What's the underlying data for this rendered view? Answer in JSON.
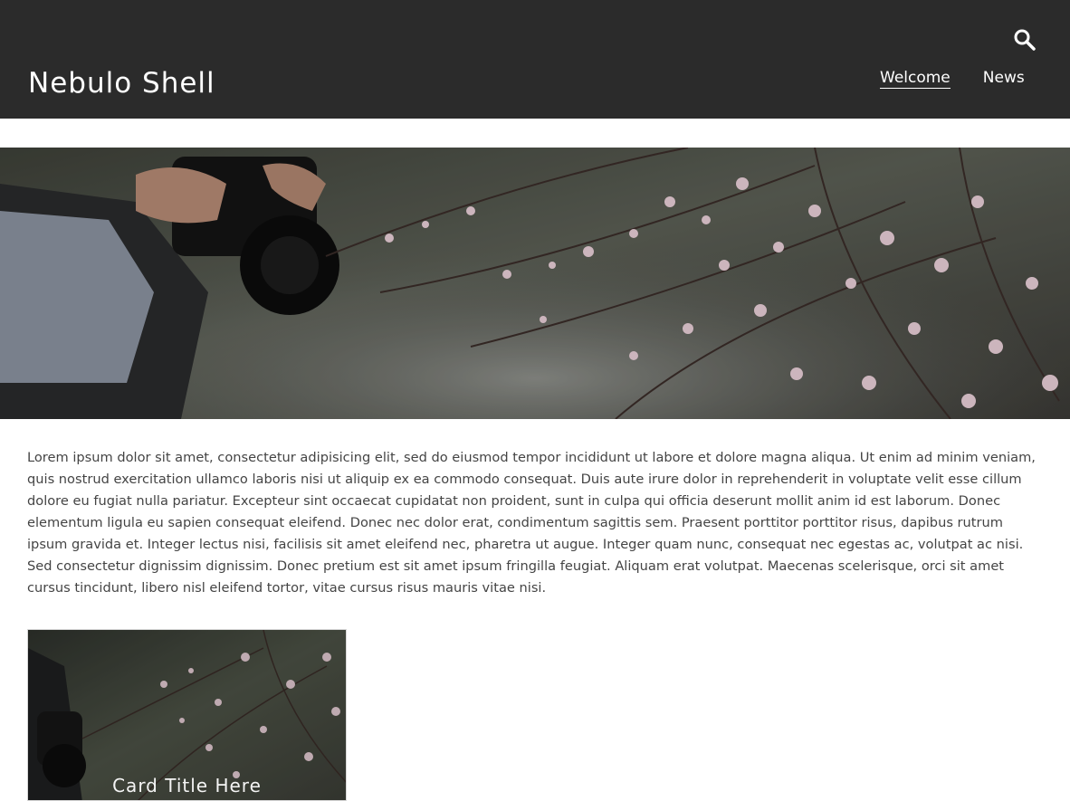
{
  "header": {
    "site_title": "Nebulo Shell",
    "search_icon": "search-icon",
    "nav": [
      {
        "label": "Welcome",
        "active": true
      },
      {
        "label": "News",
        "active": false
      }
    ]
  },
  "hero": {
    "image": "photo of hands holding a camera beside pink blossom branches"
  },
  "content": {
    "intro": "Lorem ipsum dolor sit amet, consectetur adipisicing elit, sed do eiusmod tempor incididunt ut labore et dolore magna aliqua. Ut enim ad minim veniam, quis nostrud exercitation ullamco laboris nisi ut aliquip ex ea commodo consequat. Duis aute irure dolor in reprehenderit in voluptate velit esse cillum dolore eu fugiat nulla pariatur. Excepteur sint occaecat cupidatat non proident, sunt in culpa qui officia deserunt mollit anim id est laborum. Donec elementum ligula eu sapien consequat eleifend. Donec nec dolor erat, condimentum sagittis sem. Praesent porttitor porttitor risus, dapibus rutrum ipsum gravida et. Integer lectus nisi, facilisis sit amet eleifend nec, pharetra ut augue. Integer quam nunc, consequat nec egestas ac, volutpat ac nisi. Sed consectetur dignissim dignissim. Donec pretium est sit amet ipsum fringilla feugiat. Aliquam erat volutpat. Maecenas scelerisque, orci sit amet cursus tincidunt, libero nisl eleifend tortor, vitae cursus risus mauris vitae nisi."
  },
  "card": {
    "title": "Card Title Here"
  },
  "colors": {
    "header_bg": "#2b2b2b",
    "header_text": "#ffffff",
    "body_text": "#444444",
    "page_bg": "#ffffff"
  }
}
